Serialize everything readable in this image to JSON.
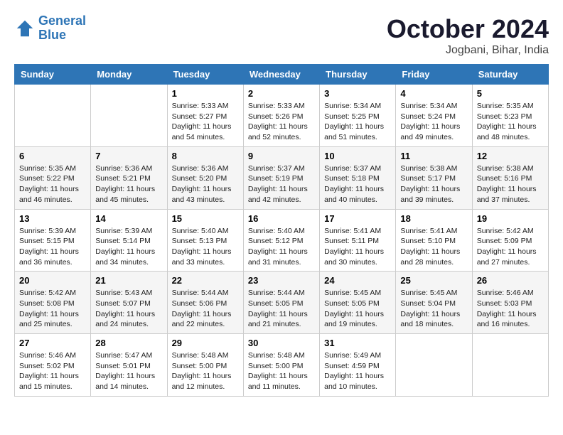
{
  "header": {
    "logo_line1": "General",
    "logo_line2": "Blue",
    "month": "October 2024",
    "location": "Jogbani, Bihar, India"
  },
  "days_of_week": [
    "Sunday",
    "Monday",
    "Tuesday",
    "Wednesday",
    "Thursday",
    "Friday",
    "Saturday"
  ],
  "weeks": [
    [
      {
        "day": "",
        "detail": ""
      },
      {
        "day": "",
        "detail": ""
      },
      {
        "day": "1",
        "detail": "Sunrise: 5:33 AM\nSunset: 5:27 PM\nDaylight: 11 hours and 54 minutes."
      },
      {
        "day": "2",
        "detail": "Sunrise: 5:33 AM\nSunset: 5:26 PM\nDaylight: 11 hours and 52 minutes."
      },
      {
        "day": "3",
        "detail": "Sunrise: 5:34 AM\nSunset: 5:25 PM\nDaylight: 11 hours and 51 minutes."
      },
      {
        "day": "4",
        "detail": "Sunrise: 5:34 AM\nSunset: 5:24 PM\nDaylight: 11 hours and 49 minutes."
      },
      {
        "day": "5",
        "detail": "Sunrise: 5:35 AM\nSunset: 5:23 PM\nDaylight: 11 hours and 48 minutes."
      }
    ],
    [
      {
        "day": "6",
        "detail": "Sunrise: 5:35 AM\nSunset: 5:22 PM\nDaylight: 11 hours and 46 minutes."
      },
      {
        "day": "7",
        "detail": "Sunrise: 5:36 AM\nSunset: 5:21 PM\nDaylight: 11 hours and 45 minutes."
      },
      {
        "day": "8",
        "detail": "Sunrise: 5:36 AM\nSunset: 5:20 PM\nDaylight: 11 hours and 43 minutes."
      },
      {
        "day": "9",
        "detail": "Sunrise: 5:37 AM\nSunset: 5:19 PM\nDaylight: 11 hours and 42 minutes."
      },
      {
        "day": "10",
        "detail": "Sunrise: 5:37 AM\nSunset: 5:18 PM\nDaylight: 11 hours and 40 minutes."
      },
      {
        "day": "11",
        "detail": "Sunrise: 5:38 AM\nSunset: 5:17 PM\nDaylight: 11 hours and 39 minutes."
      },
      {
        "day": "12",
        "detail": "Sunrise: 5:38 AM\nSunset: 5:16 PM\nDaylight: 11 hours and 37 minutes."
      }
    ],
    [
      {
        "day": "13",
        "detail": "Sunrise: 5:39 AM\nSunset: 5:15 PM\nDaylight: 11 hours and 36 minutes."
      },
      {
        "day": "14",
        "detail": "Sunrise: 5:39 AM\nSunset: 5:14 PM\nDaylight: 11 hours and 34 minutes."
      },
      {
        "day": "15",
        "detail": "Sunrise: 5:40 AM\nSunset: 5:13 PM\nDaylight: 11 hours and 33 minutes."
      },
      {
        "day": "16",
        "detail": "Sunrise: 5:40 AM\nSunset: 5:12 PM\nDaylight: 11 hours and 31 minutes."
      },
      {
        "day": "17",
        "detail": "Sunrise: 5:41 AM\nSunset: 5:11 PM\nDaylight: 11 hours and 30 minutes."
      },
      {
        "day": "18",
        "detail": "Sunrise: 5:41 AM\nSunset: 5:10 PM\nDaylight: 11 hours and 28 minutes."
      },
      {
        "day": "19",
        "detail": "Sunrise: 5:42 AM\nSunset: 5:09 PM\nDaylight: 11 hours and 27 minutes."
      }
    ],
    [
      {
        "day": "20",
        "detail": "Sunrise: 5:42 AM\nSunset: 5:08 PM\nDaylight: 11 hours and 25 minutes."
      },
      {
        "day": "21",
        "detail": "Sunrise: 5:43 AM\nSunset: 5:07 PM\nDaylight: 11 hours and 24 minutes."
      },
      {
        "day": "22",
        "detail": "Sunrise: 5:44 AM\nSunset: 5:06 PM\nDaylight: 11 hours and 22 minutes."
      },
      {
        "day": "23",
        "detail": "Sunrise: 5:44 AM\nSunset: 5:05 PM\nDaylight: 11 hours and 21 minutes."
      },
      {
        "day": "24",
        "detail": "Sunrise: 5:45 AM\nSunset: 5:05 PM\nDaylight: 11 hours and 19 minutes."
      },
      {
        "day": "25",
        "detail": "Sunrise: 5:45 AM\nSunset: 5:04 PM\nDaylight: 11 hours and 18 minutes."
      },
      {
        "day": "26",
        "detail": "Sunrise: 5:46 AM\nSunset: 5:03 PM\nDaylight: 11 hours and 16 minutes."
      }
    ],
    [
      {
        "day": "27",
        "detail": "Sunrise: 5:46 AM\nSunset: 5:02 PM\nDaylight: 11 hours and 15 minutes."
      },
      {
        "day": "28",
        "detail": "Sunrise: 5:47 AM\nSunset: 5:01 PM\nDaylight: 11 hours and 14 minutes."
      },
      {
        "day": "29",
        "detail": "Sunrise: 5:48 AM\nSunset: 5:00 PM\nDaylight: 11 hours and 12 minutes."
      },
      {
        "day": "30",
        "detail": "Sunrise: 5:48 AM\nSunset: 5:00 PM\nDaylight: 11 hours and 11 minutes."
      },
      {
        "day": "31",
        "detail": "Sunrise: 5:49 AM\nSunset: 4:59 PM\nDaylight: 11 hours and 10 minutes."
      },
      {
        "day": "",
        "detail": ""
      },
      {
        "day": "",
        "detail": ""
      }
    ]
  ]
}
